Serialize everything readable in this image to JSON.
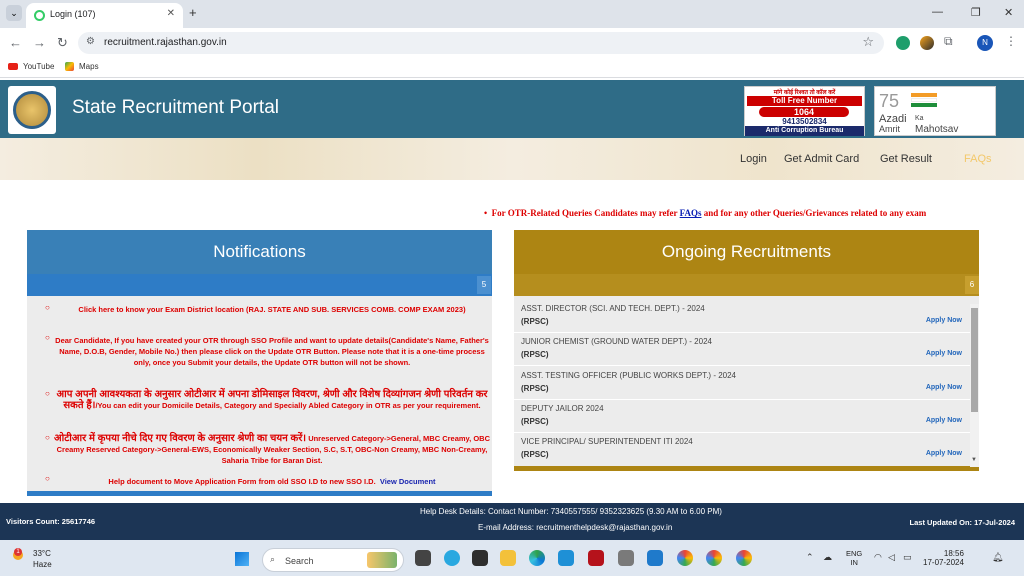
{
  "browser": {
    "tab_title": "Login (107)",
    "new_tab": "+",
    "url": "recruitment.rajasthan.gov.in",
    "profile_initial": "N",
    "bookmarks": [
      "YouTube",
      "Maps"
    ]
  },
  "site": {
    "title": "State Recruitment Portal",
    "toll": {
      "line1": "मांगे कोई रिश्वत तो कॉल करें",
      "line2": "Toll Free Number",
      "number": "1064",
      "whatsapp": "9413502834",
      "line3": "Anti Corruption Bureau"
    },
    "azadi": {
      "line1": "Azadi",
      "line2": "Ka",
      "line3": "Amrit",
      "line4": "Mahotsav"
    },
    "nav": [
      "Login",
      "Get Admit Card",
      "Get Result",
      "FAQs"
    ],
    "ticker": {
      "before": "For OTR-Related Queries Candidates may refer",
      "link": "FAQs",
      "after": "and for any other Queries/Grievances related to any exam"
    }
  },
  "notifications": {
    "title": "Notifications",
    "count": "5",
    "items": [
      {
        "text": "Click here to know your Exam District location (RAJ. STATE AND SUB. SERVICES COMB. COMP EXAM 2023)"
      },
      {
        "text": "Dear Candidate, If you have created your OTR through SSO Profile and want to update details(Candidate's Name, Father's Name, D.O.B, Gender, Mobile No.) then please click on the Update OTR Button. Please note that it is a one-time process only, once you Submit your details, the Update OTR button will not be shown."
      },
      {
        "hindi": "आप अपनी आवश्यकता के अनुसार ओटीआर में अपना डोमिसाइल विवरण, श्रेणी और विशेष दिव्यांगजन श्रेणी परिवर्तन कर सकते हैं।",
        "text": "/You can edit your Domicile Details, Category and Specially Abled Category in OTR as per your requirement."
      },
      {
        "hindi": "ओटीआर में कृपया नीचे दिए गए विवरण के अनुसार श्रेणी का चयन करें।",
        "text": "Unreserved Category->General, MBC Creamy, OBC Creamy Reserved Category->General-EWS, Economically Weaker Section, S.C, S.T, OBC-Non Creamy, MBC Non-Creamy, Saharia Tribe for Baran Dist."
      },
      {
        "text": "Help document to Move Application Form from old SSO I.D to new SSO I.D.",
        "link": "View Document"
      }
    ]
  },
  "recruitments": {
    "title": "Ongoing Recruitments",
    "count": "6",
    "apply_label": "Apply Now",
    "items": [
      {
        "name": "ASST. DIRECTOR (SCI. AND TECH. DEPT.) - 2024",
        "org": "(RPSC)"
      },
      {
        "name": "JUNIOR CHEMIST (GROUND WATER DEPT.) - 2024",
        "org": "(RPSC)"
      },
      {
        "name": "ASST. TESTING OFFICER (PUBLIC WORKS DEPT.) - 2024",
        "org": "(RPSC)"
      },
      {
        "name": "DEPUTY JAILOR 2024",
        "org": "(RPSC)"
      },
      {
        "name": "VICE PRINCIPAL/ SUPERINTENDENT ITI 2024",
        "org": "(RPSC)"
      }
    ]
  },
  "footer": {
    "visitors": "Visitors Count: 25617746",
    "helpdesk": "Help Desk Details: Contact Number: 7340557555/ 9352323625 (9.30 AM to 6.00 PM)",
    "email": "E-mail Address: recruitmenthelpdesk@rajasthan.gov.in",
    "updated": "Last Updated On: 17-Jul-2024"
  },
  "taskbar": {
    "weather_temp": "33°C",
    "weather_desc": "Haze",
    "search_placeholder": "Search",
    "lang1": "ENG",
    "lang2": "IN",
    "time": "18:56",
    "date": "17-07-2024",
    "badge": "1"
  }
}
